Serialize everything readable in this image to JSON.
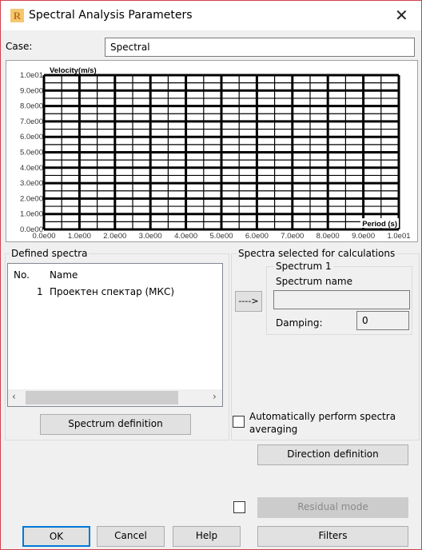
{
  "window": {
    "title": "Spectral Analysis Parameters",
    "logo": "R",
    "close_icon": "close-icon",
    "border_color": "#d0404f"
  },
  "case": {
    "label": "Case:",
    "value": "Spectral"
  },
  "chart_data": {
    "type": "line",
    "ylabel": "Velocity(m/s)",
    "xlabel": "Period (s)",
    "xlim": [
      0,
      10
    ],
    "ylim": [
      0,
      10
    ],
    "grid": true,
    "x_ticks": [
      "0.0e00",
      "1.0e00",
      "2.0e00",
      "3.0e00",
      "4.0e00",
      "5.0e00",
      "6.0e00",
      "7.0e00",
      "8.0e00",
      "9.0e00",
      "1.0e01"
    ],
    "y_ticks": [
      "0.0e00",
      "1.0e00",
      "2.0e00",
      "3.0e00",
      "4.0e00",
      "5.0e00",
      "6.0e00",
      "7.0e00",
      "8.0e00",
      "9.0e00",
      "1.0e01"
    ],
    "series": []
  },
  "defined": {
    "label": "Defined spectra",
    "columns": [
      "No.",
      "Name"
    ],
    "rows": [
      {
        "no": "1",
        "name": "Проектен спектар (МКС)"
      }
    ],
    "button": "Spectrum definition"
  },
  "selected": {
    "label": "Spectra selected for calculations",
    "arrow_button": "---->",
    "spectrum_group": "Spectrum 1",
    "name_label": "Spectrum name",
    "name_value": "",
    "damping_label": "Damping:",
    "damping_value": "0"
  },
  "averaging": {
    "label_line1": "Automatically perform spectra",
    "label_line2": "averaging",
    "checked": false
  },
  "buttons": {
    "direction": "Direction definition",
    "residual": "Residual mode",
    "ok": "OK",
    "cancel": "Cancel",
    "help": "Help",
    "filters": "Filters"
  },
  "residual_checked": false
}
